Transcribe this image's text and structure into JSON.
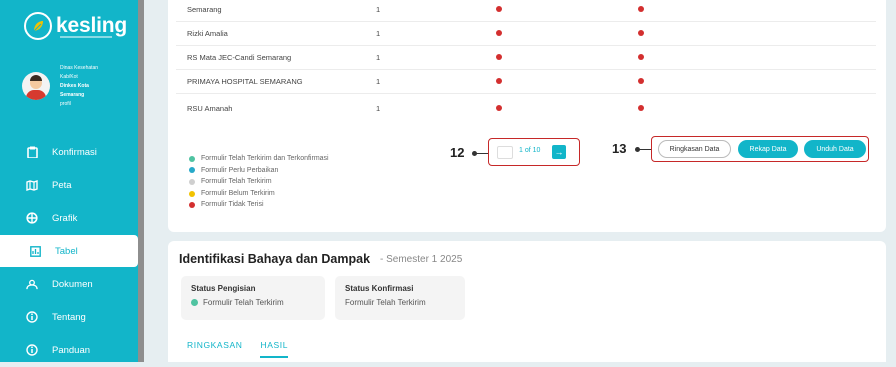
{
  "app": {
    "name": "kesling",
    "profile_lines": [
      "Dinas Kesehatan",
      "Kab/Kot",
      "Dinkes Kota",
      "Semarang",
      "profil"
    ]
  },
  "nav": {
    "items": [
      {
        "label": "Konfirmasi",
        "icon": "clipboard-icon"
      },
      {
        "label": "Peta",
        "icon": "map-icon"
      },
      {
        "label": "Grafik",
        "icon": "chart-icon"
      },
      {
        "label": "Tabel",
        "icon": "table-icon",
        "active": true
      },
      {
        "label": "Dokumen",
        "icon": "people-icon"
      },
      {
        "label": "Tentang",
        "icon": "info-icon"
      },
      {
        "label": "Panduan",
        "icon": "info-icon"
      }
    ]
  },
  "table": {
    "rows": [
      {
        "name": "Semarang",
        "count": "1"
      },
      {
        "name": "Rizki Amalia",
        "count": "1"
      },
      {
        "name": "RS Mata JEC-Candi Semarang",
        "count": "1"
      },
      {
        "name": "PRIMAYA HOSPITAL SEMARANG",
        "count": "1"
      },
      {
        "name": "RSU Amanah",
        "count": "1"
      }
    ]
  },
  "legend": [
    {
      "label": "Formulir Telah Terkirim dan Terkonfirmasi",
      "color": "#4fc3a1"
    },
    {
      "label": "Formulir Perlu Perbaikan",
      "color": "#26a9c9"
    },
    {
      "label": "Formulir Telah Terkirim",
      "color": "#cfcfcf"
    },
    {
      "label": "Formulir Belum Terkirim",
      "color": "#f2c200"
    },
    {
      "label": "Formulir Tidak Terisi",
      "color": "#d32f2f"
    }
  ],
  "pagination": {
    "text": "1 of 10",
    "callout": "12"
  },
  "actions": {
    "callout": "13",
    "ringkasan": "Ringkasan Data",
    "rekap": "Rekap Data",
    "unduh": "Unduh Data"
  },
  "section": {
    "title": "Identifikasi Bahaya dan Dampak",
    "subtitle": "- Semester 1 2025",
    "status_pengisian_label": "Status Pengisian",
    "status_pengisian_value": "Formulir Telah Terkirim",
    "status_konfirmasi_label": "Status Konfirmasi",
    "status_konfirmasi_value": "Formulir Telah Terkirim",
    "tabs": [
      "RINGKASAN",
      "HASIL"
    ]
  },
  "colors": {
    "accent": "#12b5c9",
    "alert": "#d32f2f"
  }
}
